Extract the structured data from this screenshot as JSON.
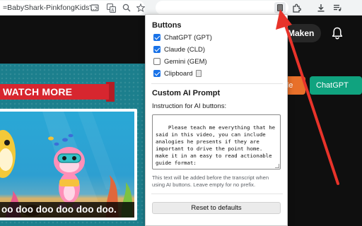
{
  "browser": {
    "tab_url_text": "=BabyShark-PinkfongKids'...",
    "icons": [
      "open-in-app-icon",
      "translate-icon",
      "zoom-icon",
      "bookmark-star-icon",
      "extension-icon",
      "extensions-puzzle-icon",
      "download-icon",
      "media-queue-icon"
    ]
  },
  "youtube": {
    "join_button_label": "Maken",
    "claude_chip_label": "ude",
    "chatgpt_chip_label": "ChatGPT",
    "video": {
      "banner_text": "WATCH MORE",
      "caption_text": "oo doo doo doo doo doo."
    }
  },
  "popup": {
    "buttons_title": "Buttons",
    "options": [
      {
        "label": "ChatGPT (GPT)",
        "checked": true
      },
      {
        "label": "Claude (CLD)",
        "checked": true
      },
      {
        "label": "Gemini (GEM)",
        "checked": false
      },
      {
        "label": "Clipboard",
        "checked": true
      }
    ],
    "prompt_title": "Custom AI Prompt",
    "instruction_label": "Instruction for AI buttons:",
    "prompt_value": "Please teach me everything that he said in this video, you can include analogies he presents if they are important to drive the point home. make it in an easy to read actionable guide format:",
    "help_text": "This text will be added before the transcript when using AI buttons. Leave empty for no prefix.",
    "reset_label": "Reset to defaults"
  },
  "colors": {
    "checkbox_accent": "#1a73e8",
    "arrow": "#e8332a",
    "claude_chip": "#e8702a",
    "chatgpt_chip": "#10a37f",
    "banner": "#d7262f"
  }
}
